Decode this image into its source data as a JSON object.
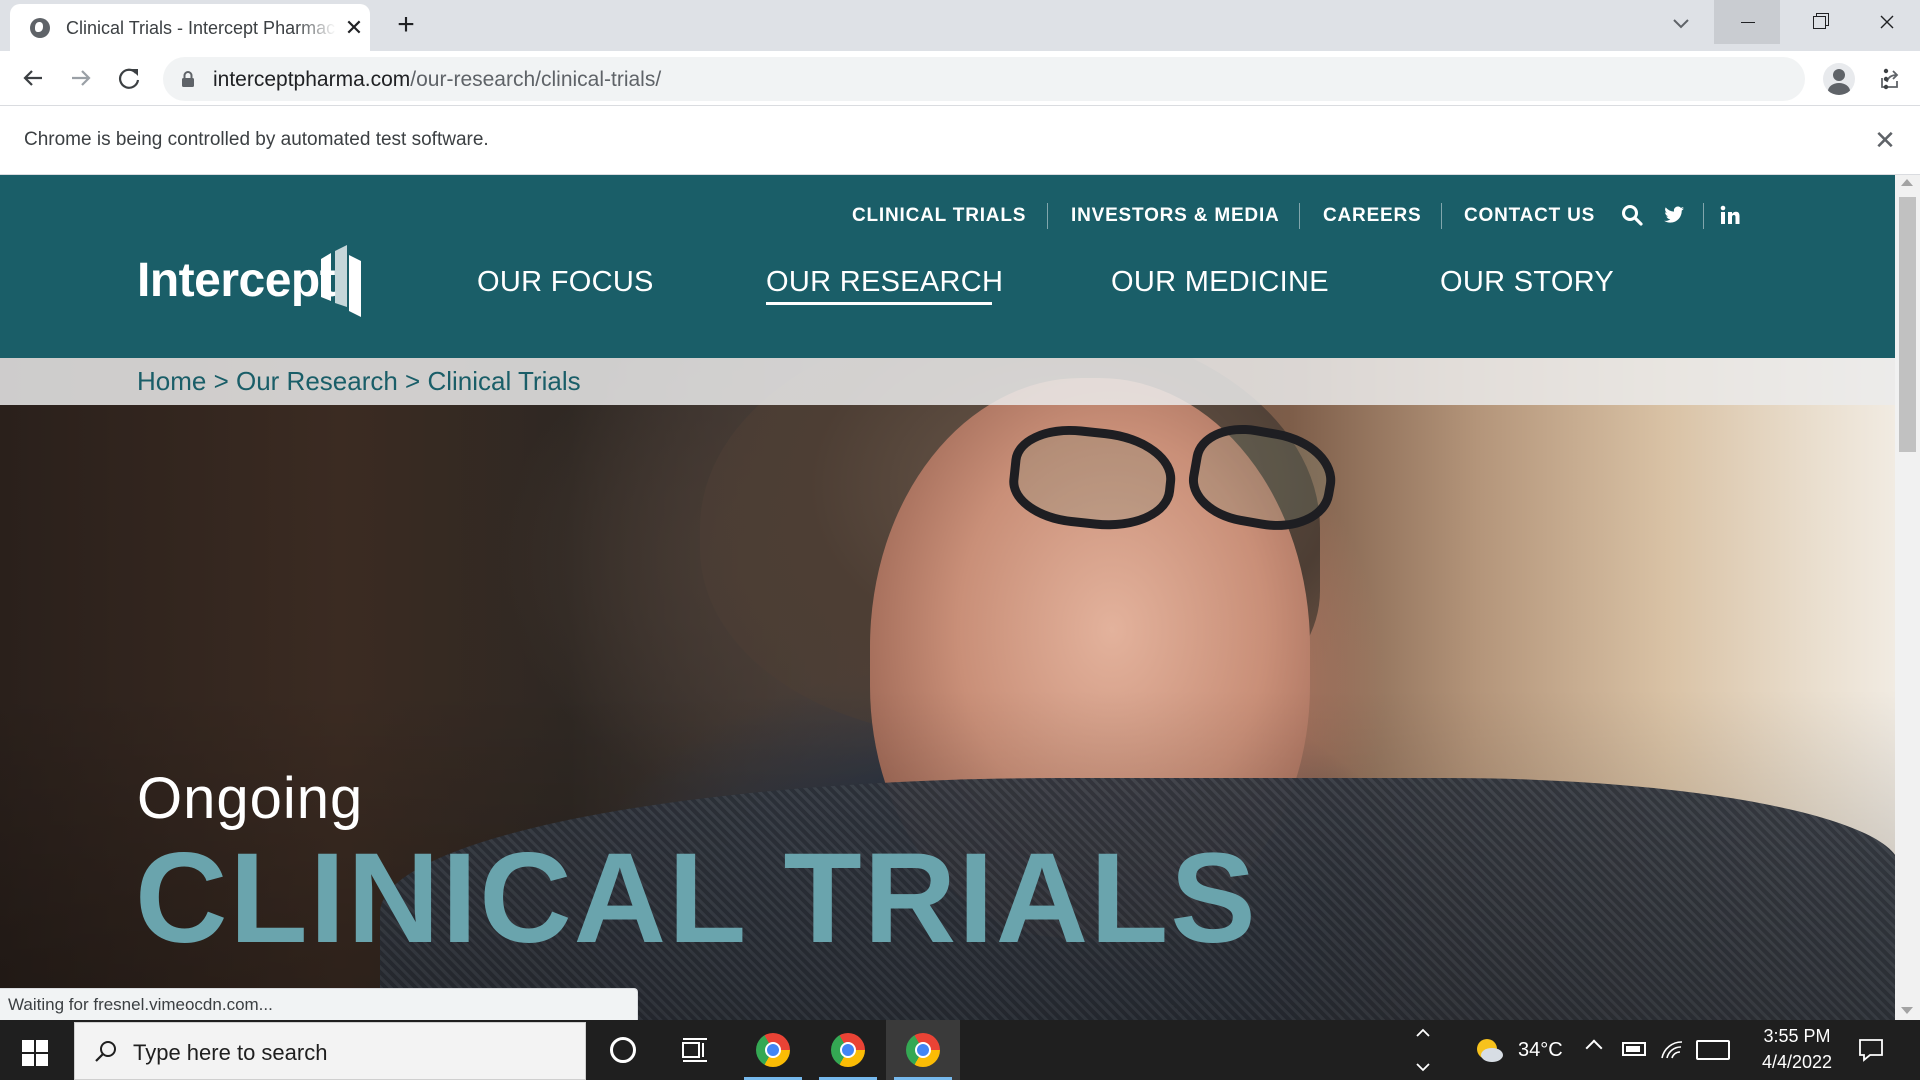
{
  "browser": {
    "tab_title": "Clinical Trials - Intercept Pharmaceuticals",
    "url_host": "interceptpharma.com",
    "url_path": "/our-research/clinical-trials/",
    "infobar_text": "Chrome is being controlled by automated test software.",
    "status_text": "Waiting for fresnel.vimeocdn.com..."
  },
  "site": {
    "logo_text": "Intercept",
    "utility_nav": [
      "CLINICAL TRIALS",
      "INVESTORS & MEDIA",
      "CAREERS",
      "CONTACT US"
    ],
    "main_nav": [
      "OUR FOCUS",
      "OUR RESEARCH",
      "OUR MEDICINE",
      "OUR STORY"
    ],
    "active_main_nav": "OUR RESEARCH",
    "breadcrumb": "Home > Our Research > Clinical Trials",
    "hero_kicker": "Ongoing",
    "hero_title": "CLINICAL TRIALS",
    "colors": {
      "header_bg": "#1a5e68",
      "hero_title": "#6aa4ad"
    },
    "icons": [
      "search-icon",
      "twitter-icon",
      "linkedin-icon"
    ]
  },
  "taskbar": {
    "search_placeholder": "Type here to search",
    "weather": "34°C",
    "time": "3:55 PM",
    "date": "4/4/2022"
  }
}
